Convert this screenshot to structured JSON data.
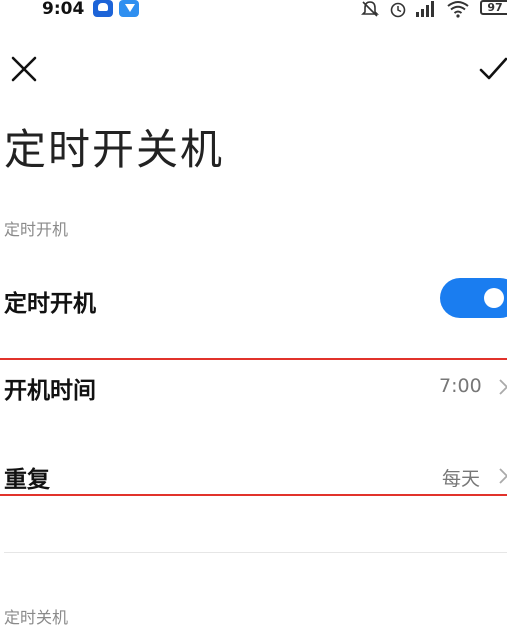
{
  "status_bar": {
    "time": "9:04",
    "battery": "97",
    "icons": [
      "app-icon",
      "app-icon",
      "bell-off-icon",
      "alarm-icon",
      "signal-icon",
      "wifi-icon",
      "battery-icon"
    ]
  },
  "header": {
    "close_icon": "close-icon",
    "confirm_icon": "check-icon"
  },
  "page": {
    "title": "定时开关机"
  },
  "power_on_section": {
    "label": "定时开机",
    "toggle_label": "定时开机",
    "toggle_on": true,
    "time_label": "开机时间",
    "time_value": "7:00",
    "repeat_label": "重复",
    "repeat_value": "每天"
  },
  "power_off_section": {
    "label": "定时关机"
  },
  "colors": {
    "accent": "#1a7df0",
    "highlight": "#e1322b"
  }
}
